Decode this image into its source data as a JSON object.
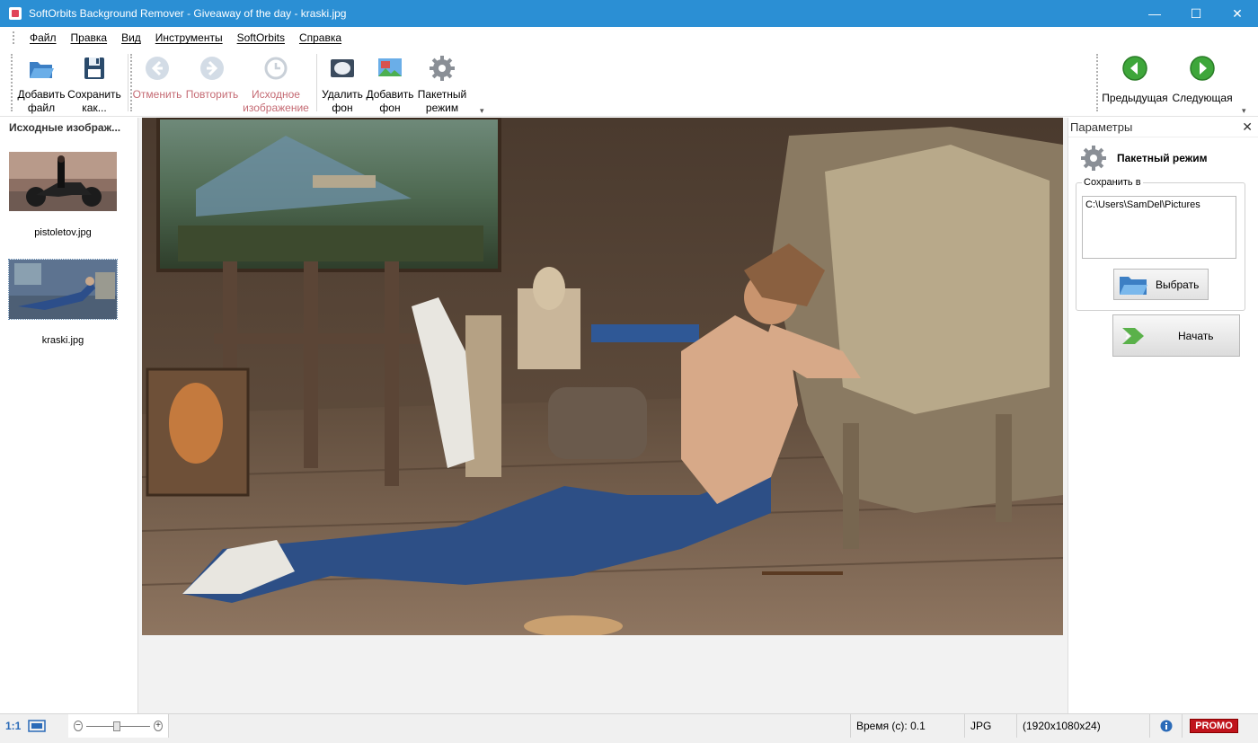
{
  "window": {
    "title": "SoftOrbits Background Remover - Giveaway of the day - kraski.jpg",
    "controls": {
      "minimize": "—",
      "maximize": "☐",
      "close": "✕"
    }
  },
  "menu": [
    "Файл",
    "Правка",
    "Вид",
    "Инструменты",
    "SoftOrbits",
    "Справка"
  ],
  "toolbar": {
    "add_file": {
      "line1": "Добавить",
      "line2": "файл",
      "icon": "folder-open-icon"
    },
    "save_as": {
      "line1": "Сохранить",
      "line2": "как...",
      "icon": "floppy-disk-icon"
    },
    "undo": {
      "label": "Отменить",
      "icon": "arrow-left-circle-icon"
    },
    "redo": {
      "label": "Повторить",
      "icon": "arrow-right-circle-icon"
    },
    "original": {
      "line1": "Исходное",
      "line2": "изображение",
      "icon": "history-clock-icon"
    },
    "remove_bg": {
      "line1": "Удалить",
      "line2": "фон",
      "icon": "eraser-icon"
    },
    "add_bg": {
      "line1": "Добавить",
      "line2": "фон",
      "icon": "picture-icon"
    },
    "batch": {
      "line1": "Пакетный",
      "line2": "режим",
      "icon": "gear-icon"
    },
    "prev": {
      "label": "Предыдущая",
      "icon": "green-left-arrow-icon"
    },
    "next": {
      "label": "Следующая",
      "icon": "green-right-arrow-icon"
    }
  },
  "sources": {
    "header": "Исходные изображ...",
    "items": [
      {
        "name": "pistoletov.jpg"
      },
      {
        "name": "kraski.jpg"
      }
    ]
  },
  "params": {
    "header": "Параметры",
    "close": "✕",
    "batch_label": "Пакетный режим",
    "save_to_label": "Сохранить в",
    "save_path": "C:\\Users\\SamDel\\Pictures",
    "choose_button": "Выбрать",
    "start_button": "Начать"
  },
  "status": {
    "scale_label": "1:1",
    "time": "Время (с): 0.1",
    "format": "JPG",
    "dimensions": "(1920x1080x24)",
    "info_icon": "info-icon",
    "promo": "PROMO"
  },
  "colors": {
    "titlebar": "#2b8fd4",
    "promo": "#c0141c",
    "nav_green": "#3ea63a"
  }
}
